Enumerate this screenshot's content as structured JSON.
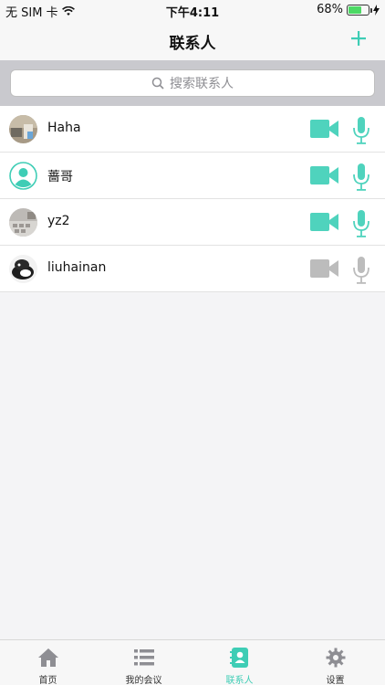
{
  "status_bar": {
    "carrier": "无 SIM 卡",
    "time": "下午4:11",
    "battery": "68%",
    "battery_level": 0.68
  },
  "navbar": {
    "title": "联系人"
  },
  "search": {
    "placeholder": "搜索联系人"
  },
  "contacts": [
    {
      "name": "Haha",
      "calls_enabled": true
    },
    {
      "name": "蔷哥",
      "calls_enabled": true
    },
    {
      "name": "yz2",
      "calls_enabled": true
    },
    {
      "name": "liuhainan",
      "calls_enabled": false
    }
  ],
  "tabbar": {
    "tabs": [
      {
        "label": "首页",
        "icon": "home-icon"
      },
      {
        "label": "我的会议",
        "icon": "list-icon"
      },
      {
        "label": "联系人",
        "icon": "contacts-icon",
        "active": true
      },
      {
        "label": "设置",
        "icon": "gear-icon"
      }
    ]
  },
  "colors": {
    "accent": "#3ecdb5",
    "disabled": "#bcbcbc"
  }
}
